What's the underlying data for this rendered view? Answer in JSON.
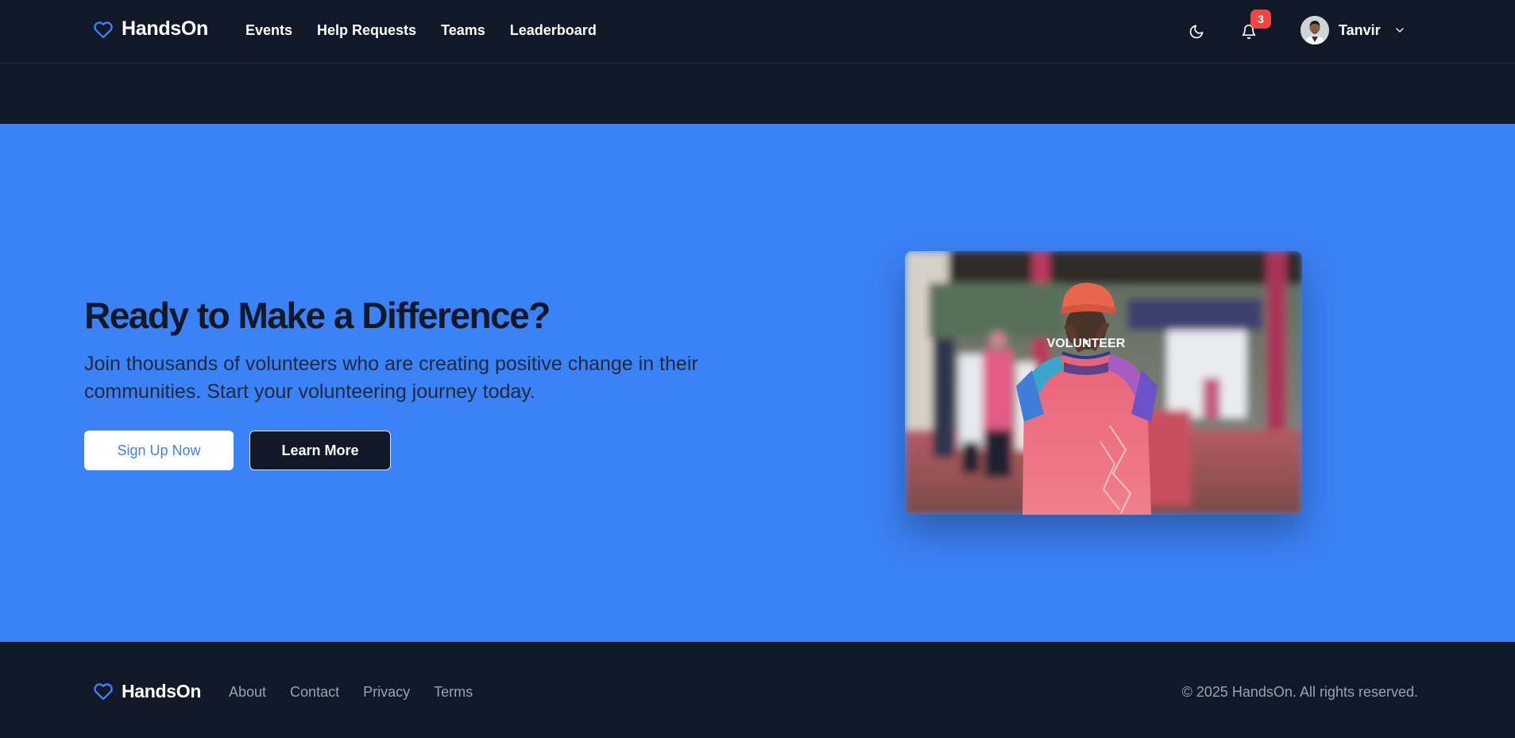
{
  "header": {
    "brand": "HandsOn",
    "nav": [
      {
        "label": "Events"
      },
      {
        "label": "Help Requests"
      },
      {
        "label": "Teams"
      },
      {
        "label": "Leaderboard"
      }
    ],
    "theme_icon": "moon-icon",
    "notifications": {
      "icon": "bell-icon",
      "count": "3"
    },
    "user": {
      "name": "Tanvir",
      "menu_icon": "chevron-down-icon"
    }
  },
  "hero": {
    "title": "Ready to Make a Difference?",
    "text": "Join thousands of volunteers who are creating positive change in their communities. Start your volunteering journey today.",
    "primary_button": "Sign Up Now",
    "secondary_button": "Learn More",
    "image_shirt_text": "VOLUNTEER"
  },
  "footer": {
    "brand": "HandsOn",
    "links": [
      {
        "label": "About"
      },
      {
        "label": "Contact"
      },
      {
        "label": "Privacy"
      },
      {
        "label": "Terms"
      }
    ],
    "copyright": "© 2025 HandsOn. All rights reserved."
  },
  "colors": {
    "navy": "#111827",
    "accent": "#3b82f6",
    "badge": "#ef4444",
    "muted": "#9ca3af"
  }
}
